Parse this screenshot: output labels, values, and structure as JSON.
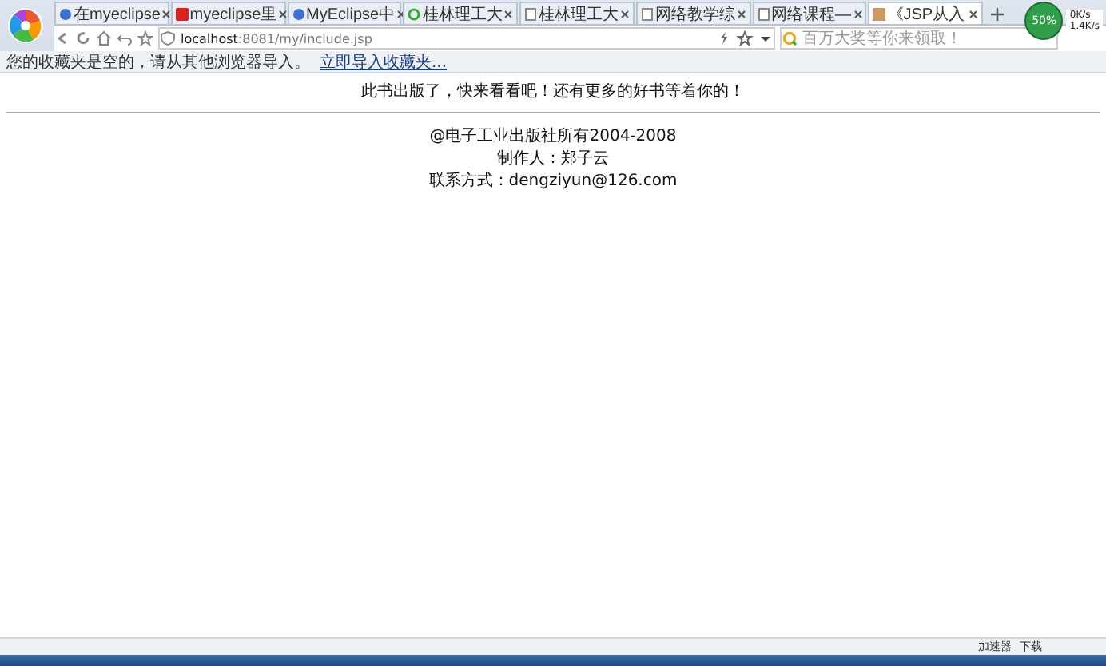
{
  "tabs": [
    {
      "title": "在myeclipse",
      "selected": false
    },
    {
      "title": "myeclipse里",
      "selected": false
    },
    {
      "title": "MyEclipse中",
      "selected": false
    },
    {
      "title": "桂林理工大",
      "selected": false
    },
    {
      "title": "桂林理工大",
      "selected": false
    },
    {
      "title": "网络教学综",
      "selected": false
    },
    {
      "title": "网络课程—",
      "selected": false
    },
    {
      "title": "《JSP从入",
      "selected": true
    }
  ],
  "speed": {
    "percent": "50%",
    "up": "0K/s",
    "down": "1.4K/s"
  },
  "address": {
    "host": "localhost",
    "path": ":8081/my/include.jsp"
  },
  "search": {
    "placeholder": "百万大奖等你来领取！"
  },
  "bookmarks_bar": {
    "message": "您的收藏夹是空的，请从其他浏览器导入。",
    "link": "立即导入收藏夹..."
  },
  "page": {
    "banner": "此书出版了，快来看看吧！还有更多的好书等着你的！",
    "footer_lines": [
      "@电子工业出版社所有2004-2008",
      "制作人：郑子云",
      "联系方式：dengziyun@126.com"
    ]
  },
  "status_bar": {
    "items": [
      "加速器",
      "下载"
    ]
  }
}
